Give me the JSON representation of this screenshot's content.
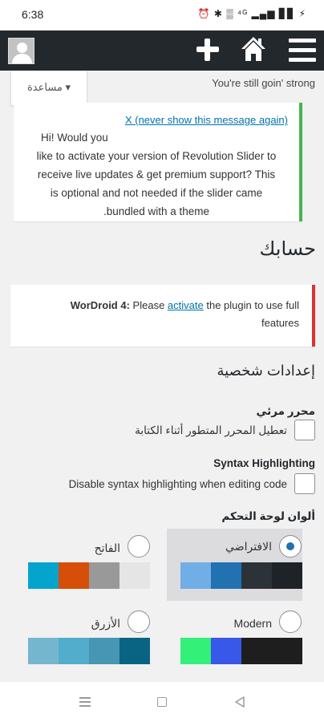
{
  "status_bar": {
    "time": "6:38",
    "icons_text": "⏰ ✱ ▒ ⁴ᴳ ▂▄▆ ▊▊ ⚡"
  },
  "admin_bar": {
    "icons": [
      "avatar",
      "plus-icon",
      "home-icon",
      "menu-icon"
    ],
    "background": "#23282d"
  },
  "help_tab": {
    "label": "مساعدة ▾"
  },
  "greeting": "You're still goin' strong",
  "revslider_notice": {
    "dismiss_link": "X  (never show this message again)",
    "line1": "Hi! Would you",
    "line2": "like to activate your version of Revolution Slider to",
    "line3": "receive live updates & get premium support? This",
    "line4": "is optional and not needed if the slider came",
    "line5": ".bundled with a theme",
    "border_color": "#46b450"
  },
  "page_title": "حسابك",
  "wordroid_notice": {
    "strong": "WorDroid 4:",
    "before_link": "Please",
    "link": "activate",
    "after_link": "the plugin to use full",
    "line2": "features",
    "border_color": "#dc3232"
  },
  "personal_options": {
    "title": "إعدادات شخصية",
    "visual_editor": {
      "label": "محرر مرئي",
      "checkbox_text": "تعطيل المحرر المتطور أثناء الكتابة",
      "checked": false
    },
    "syntax_highlighting": {
      "label": "Syntax Highlighting",
      "checkbox_text": "Disable syntax highlighting when editing code",
      "checked": false
    },
    "admin_color": {
      "label": "ألوان لوحة التحكم",
      "schemes": [
        {
          "name": "الافتراضي",
          "selected": true,
          "colors": [
            "#1d2327",
            "#2c3338",
            "#2271b1",
            "#72aee6"
          ]
        },
        {
          "name": "الفاتح",
          "selected": false,
          "colors": [
            "#e5e5e5",
            "#999999",
            "#d64e07",
            "#04a4cc"
          ]
        },
        {
          "name": "Modern",
          "selected": false,
          "colors": [
            "#1e1e1e",
            "#3858e9",
            "#33f078",
            "#ffffff"
          ]
        },
        {
          "name": "الأزرق",
          "selected": false,
          "colors": [
            "#096484",
            "#4796b3",
            "#52accc",
            "#74b6ce"
          ]
        }
      ]
    }
  },
  "nav_bar": {
    "buttons": [
      "recents",
      "home",
      "back"
    ]
  }
}
